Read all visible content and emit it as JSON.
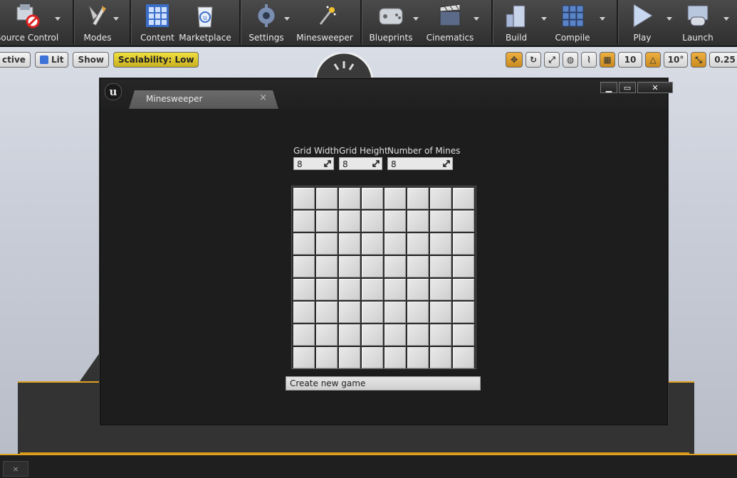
{
  "toolbar": {
    "items": [
      {
        "label": "Source Control",
        "icon": "source-control-icon"
      },
      {
        "label": "Modes",
        "icon": "modes-icon"
      },
      {
        "label": "Content",
        "icon": "content-icon"
      },
      {
        "label": "Marketplace",
        "icon": "marketplace-icon"
      },
      {
        "label": "Settings",
        "icon": "settings-icon"
      },
      {
        "label": "Minesweeper",
        "icon": "minesweeper-icon"
      },
      {
        "label": "Blueprints",
        "icon": "blueprints-icon"
      },
      {
        "label": "Cinematics",
        "icon": "cinematics-icon"
      },
      {
        "label": "Build",
        "icon": "build-icon"
      },
      {
        "label": "Compile",
        "icon": "compile-icon"
      },
      {
        "label": "Play",
        "icon": "play-icon"
      },
      {
        "label": "Launch",
        "icon": "launch-icon"
      }
    ]
  },
  "viewport": {
    "perspective_label": "ctive",
    "lit_label": "Lit",
    "show_label": "Show",
    "scalability_label": "Scalability: Low",
    "grid_snap": "10",
    "rotation_snap": "10°",
    "scale_snap": "0.25"
  },
  "window": {
    "tab_label": "Minesweeper",
    "tab_close": "×",
    "minimize": "▁",
    "maximize": "▭",
    "close": "✕"
  },
  "form": {
    "grid_width_label": "Grid Width",
    "grid_width_value": "8",
    "grid_height_label": "Grid Height",
    "grid_height_value": "8",
    "mines_label": "Number of Mines",
    "mines_value": "8",
    "create_button": "Create new game"
  },
  "board": {
    "rows": 8,
    "cols": 8
  },
  "bottom": {
    "tab_close": "×"
  },
  "colors": {
    "accent": "#e0a020",
    "window_bg": "#1d1d1d",
    "cell": "#dcdcdc"
  }
}
